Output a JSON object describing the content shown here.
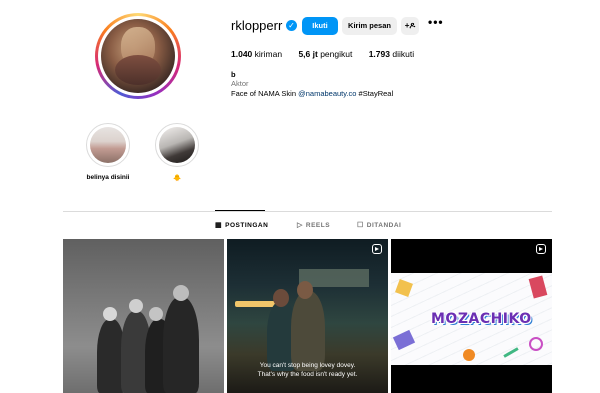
{
  "profile": {
    "username": "rklopperr",
    "verified_mark": "✓",
    "buttons": {
      "follow": "Ikuti",
      "message": "Kirim pesan",
      "suggest_icon": "+ዶ",
      "more_icon": "•••"
    },
    "stats": {
      "posts_value": "1.040",
      "posts_label": "kiriman",
      "followers_value": "5,6 jt",
      "followers_label": "pengikut",
      "following_value": "1.793",
      "following_label": "diikuti"
    },
    "bio": {
      "name": "b",
      "category": "Aktor",
      "text_prefix": "Face of NAMA Skin ",
      "mention": "@namabeauty.co",
      "text_suffix": " #StayReal"
    }
  },
  "highlights": [
    {
      "label": "belinya disinii"
    },
    {
      "label": "🐥"
    }
  ],
  "tabs": [
    {
      "icon": "▦",
      "label": "POSTINGAN",
      "active": true
    },
    {
      "icon": "▷",
      "label": "REELS",
      "active": false
    },
    {
      "icon": "☐",
      "label": "DITANDAI",
      "active": false
    }
  ],
  "posts": [
    {
      "type": "image"
    },
    {
      "type": "reel",
      "caption_line1": "You can't stop being lovey dovey.",
      "caption_line2": "That's why the food isn't ready yet."
    },
    {
      "type": "reel",
      "card_title": "MOZACHIKO"
    }
  ],
  "colors": {
    "accent": "#0095f6",
    "mention": "#00376b",
    "muted": "#737373"
  }
}
